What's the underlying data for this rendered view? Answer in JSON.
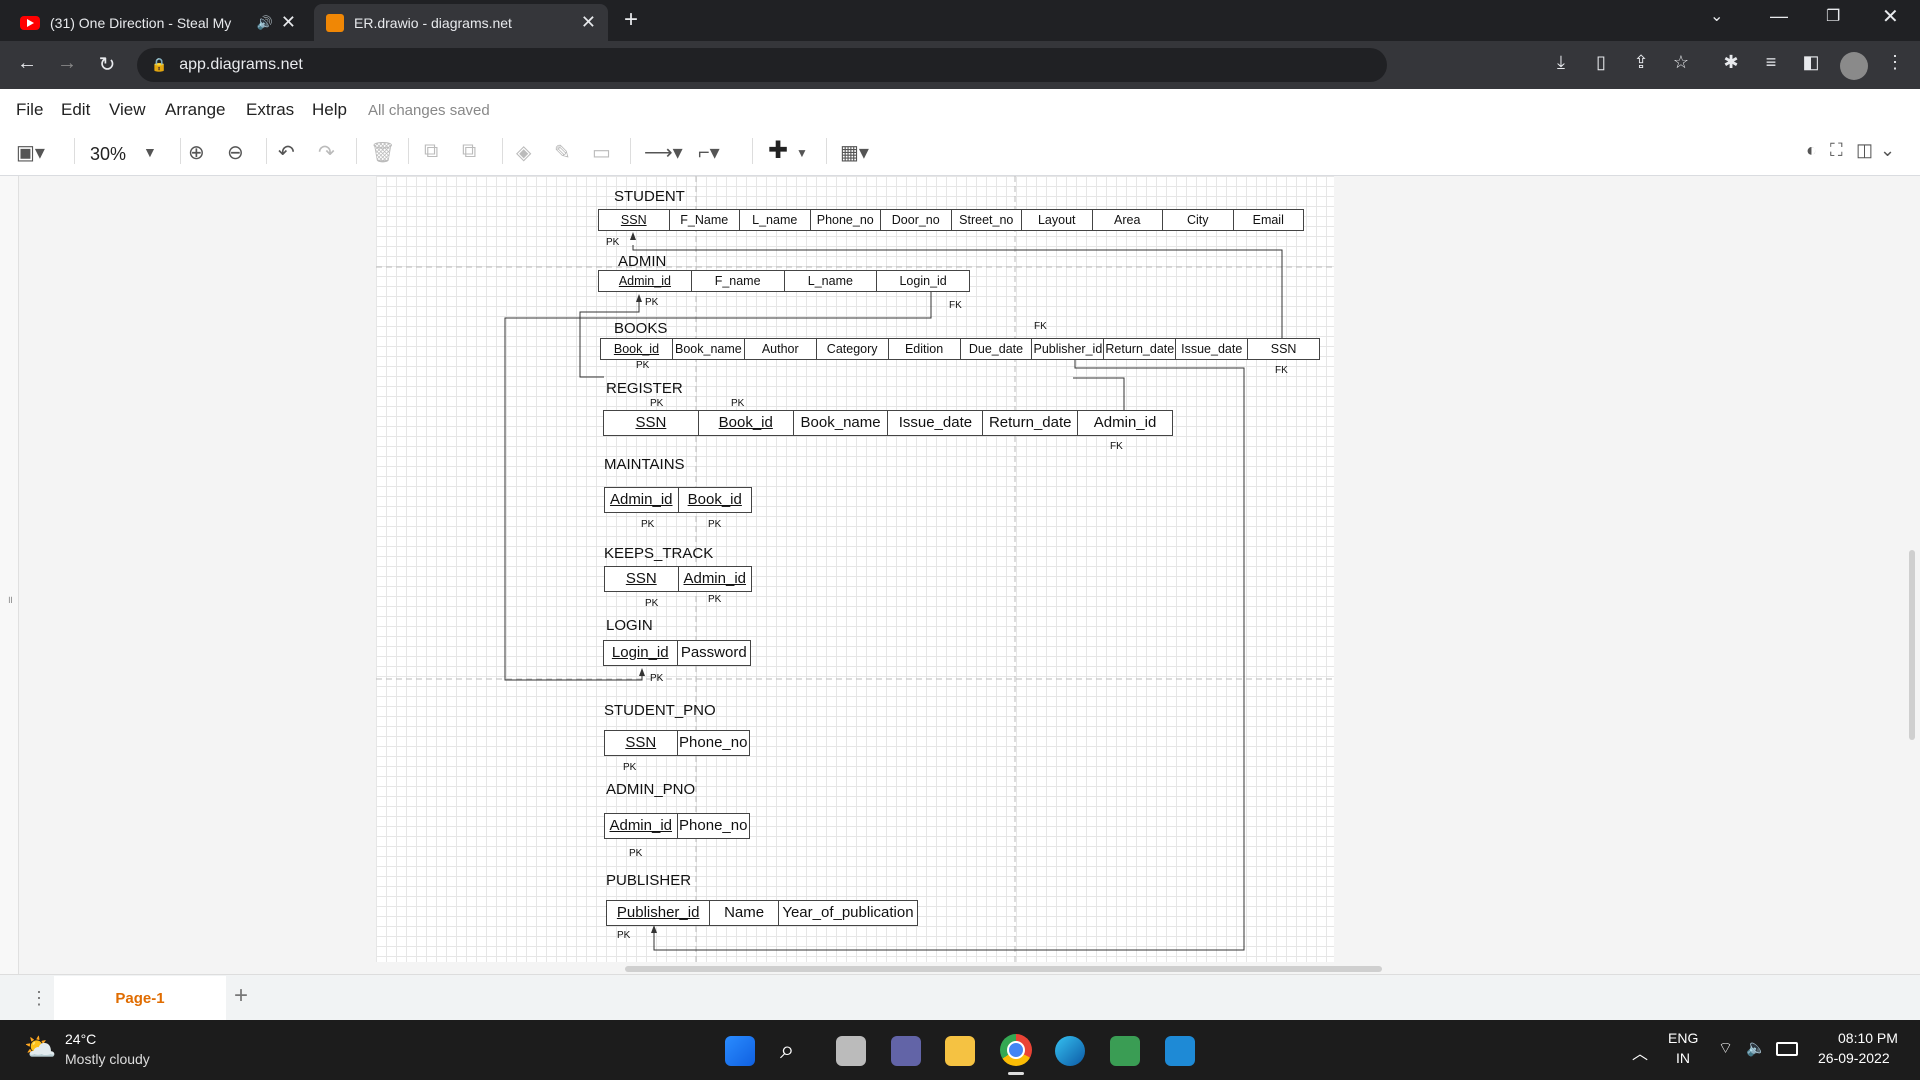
{
  "browser": {
    "tabs": [
      {
        "title": "(31) One Direction - Steal My",
        "active": false
      },
      {
        "title": "ER.drawio - diagrams.net",
        "active": true
      }
    ],
    "url": "app.diagrams.net"
  },
  "app": {
    "menu": [
      "File",
      "Edit",
      "View",
      "Arrange",
      "Extras",
      "Help"
    ],
    "status": "All changes saved",
    "zoom": "30%"
  },
  "diagram": {
    "student": {
      "title": "STUDENT",
      "cols": [
        "SSN",
        "F_Name",
        "L_name",
        "Phone_no",
        "Door_no",
        "Street_no",
        "Layout",
        "Area",
        "City",
        "Email"
      ],
      "pk": "PK"
    },
    "admin": {
      "title": "ADMIN",
      "cols": [
        "Admin_id",
        "F_name",
        "L_name",
        "Login_id"
      ],
      "pk": "PK",
      "fk": "FK"
    },
    "books": {
      "title": "BOOKS",
      "cols": [
        "Book_id",
        "Book_name",
        "Author",
        "Category",
        "Edition",
        "Due_date",
        "Publisher_id",
        "Return_date",
        "Issue_date",
        "SSN"
      ],
      "pk": "PK",
      "fk_top": "FK",
      "fk_right": "FK"
    },
    "register": {
      "title": "REGISTER",
      "cols": [
        "SSN",
        "Book_id",
        "Book_name",
        "Issue_date",
        "Return_date",
        "Admin_id"
      ],
      "pk1": "PK",
      "pk2": "PK",
      "fk": "FK"
    },
    "maintains": {
      "title": "MAINTAINS",
      "cols": [
        "Admin_id",
        "Book_id"
      ],
      "pk1": "PK",
      "pk2": "PK"
    },
    "keeps_track": {
      "title": "KEEPS_TRACK",
      "cols": [
        "SSN",
        "Admin_id"
      ],
      "pk1": "PK",
      "pk2": "PK"
    },
    "login": {
      "title": "LOGIN",
      "cols": [
        "Login_id",
        "Password"
      ],
      "pk": "PK"
    },
    "student_pno": {
      "title": "STUDENT_PNO",
      "cols": [
        "SSN",
        "Phone_no"
      ],
      "pk": "PK"
    },
    "admin_pno": {
      "title": "ADMIN_PNO",
      "cols": [
        "Admin_id",
        "Phone_no"
      ],
      "pk": "PK"
    },
    "publisher": {
      "title": "PUBLISHER",
      "cols": [
        "Publisher_id",
        "Name",
        "Year_of_publication"
      ],
      "pk": "PK"
    }
  },
  "pages": {
    "current": "Page-1"
  },
  "taskbar": {
    "weather_temp": "24°C",
    "weather_desc": "Mostly cloudy",
    "lang": "ENG",
    "region": "IN",
    "time": "08:10 PM",
    "date": "26-09-2022"
  }
}
